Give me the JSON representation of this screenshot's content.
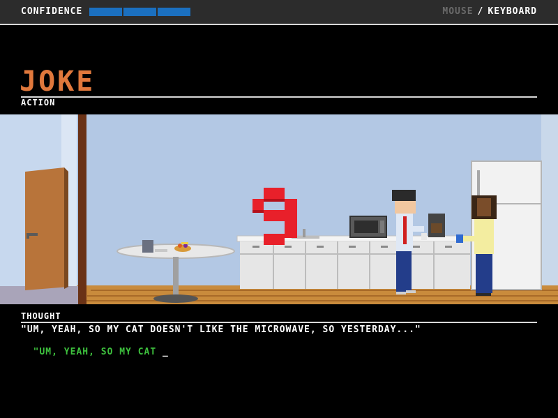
{
  "hud": {
    "confidence_label": "CONFIDENCE",
    "confidence_segments": 3,
    "confidence_color": "#1b70c0",
    "input_mode_mouse": "MOUSE",
    "input_mode_separator": "/",
    "input_mode_keyboard": "KEYBOARD"
  },
  "action": {
    "title": "JOKE",
    "label": "ACTION",
    "title_color": "#e0783c"
  },
  "scene": {
    "countdown": "3",
    "countdown_color": "#e8202a"
  },
  "thought": {
    "label": "THOUGHT",
    "target_text": "\"UM, YEAH, SO MY CAT DOESN'T LIKE THE MICROWAVE, SO YESTERDAY...\"",
    "typed_text": "\"UM, YEAH, SO MY CAT ",
    "cursor": "_",
    "typed_color": "#3ec23e"
  }
}
